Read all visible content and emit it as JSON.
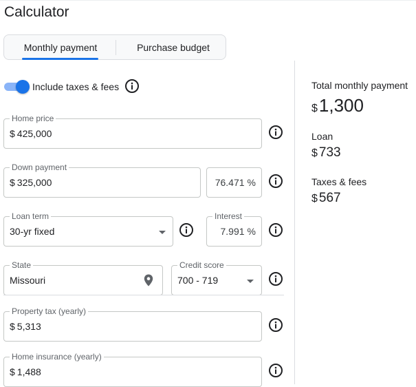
{
  "title": "Calculator",
  "tabs": [
    {
      "label": "Monthly payment",
      "selected": true
    },
    {
      "label": "Purchase budget",
      "selected": false
    }
  ],
  "toggle": {
    "label": "Include taxes & fees",
    "on": true
  },
  "form": {
    "home_price": {
      "label": "Home price",
      "currency": "$",
      "value": "425,000"
    },
    "down_payment": {
      "label": "Down payment",
      "currency": "$",
      "value": "325,000",
      "percent": "76.471",
      "percent_unit": "%"
    },
    "loan_term": {
      "label": "Loan term",
      "value": "30-yr fixed"
    },
    "interest": {
      "label": "Interest",
      "value": "7.991",
      "unit": "%"
    },
    "state": {
      "label": "State",
      "value": "Missouri"
    },
    "credit_score": {
      "label": "Credit score",
      "value": "700 - 719"
    },
    "property_tax": {
      "label": "Property tax (yearly)",
      "currency": "$",
      "value": "5,313"
    },
    "home_insurance": {
      "label": "Home insurance (yearly)",
      "currency": "$",
      "value": "1,488"
    }
  },
  "summary": {
    "total": {
      "label": "Total monthly payment",
      "currency": "$",
      "value": "1,300"
    },
    "loan": {
      "label": "Loan",
      "currency": "$",
      "value": "733"
    },
    "taxes": {
      "label": "Taxes & fees",
      "currency": "$",
      "value": "567"
    }
  },
  "colors": {
    "accent": "#1a73e8",
    "toggle_track": "#8ab4f8",
    "border": "#c4c7c5",
    "text": "#202124"
  },
  "icons": [
    "info-icon",
    "chevron-down-icon",
    "location-pin-icon"
  ]
}
